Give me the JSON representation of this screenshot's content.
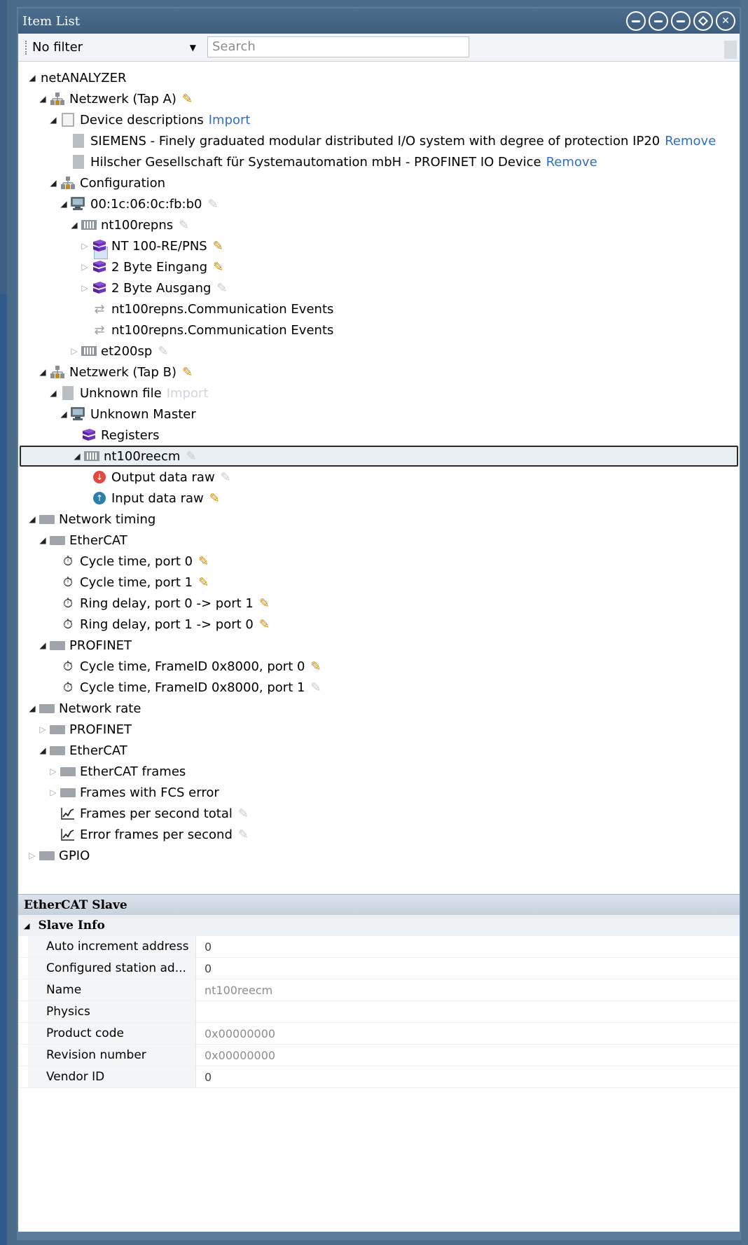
{
  "window": {
    "title": "Item List",
    "buttons": [
      "⊖",
      "⊖",
      "⊜",
      "⊕",
      "⊗"
    ]
  },
  "toolbar": {
    "filter_value": "No filter",
    "search_placeholder": "Search"
  },
  "tree": [
    {
      "depth": 0,
      "exp": "open",
      "icon": "none",
      "label": "netANALYZER"
    },
    {
      "depth": 1,
      "exp": "open",
      "icon": "network",
      "label": "Netzwerk (Tap A)",
      "pencil": "active"
    },
    {
      "depth": 2,
      "exp": "open",
      "icon": "doc",
      "label": "Device descriptions",
      "link": "Import"
    },
    {
      "depth": 3,
      "exp": "none",
      "icon": "docfill",
      "label": "SIEMENS - Finely graduated modular distributed I/O system with degree of protection IP20",
      "link": "Remove"
    },
    {
      "depth": 3,
      "exp": "none",
      "icon": "docfill",
      "label": "Hilscher Gesellschaft für Systemautomation mbH - PROFINET IO Device",
      "link": "Remove"
    },
    {
      "depth": 2,
      "exp": "open",
      "icon": "network",
      "label": "Configuration"
    },
    {
      "depth": 3,
      "exp": "open",
      "icon": "pc",
      "label": "00:1c:06:0c:fb:b0",
      "pencil": "dim"
    },
    {
      "depth": 4,
      "exp": "open",
      "icon": "card",
      "label": "nt100repns",
      "pencil": "dim"
    },
    {
      "depth": 5,
      "exp": "closed",
      "icon": "module",
      "label": "NT 100-RE/PNS",
      "pencil": "active"
    },
    {
      "depth": 5,
      "exp": "closed",
      "icon": "module",
      "label": "2 Byte Eingang",
      "pencil": "active"
    },
    {
      "depth": 5,
      "exp": "closed",
      "icon": "module",
      "label": "2 Byte Ausgang",
      "pencil": "dim"
    },
    {
      "depth": 5,
      "exp": "none",
      "icon": "event",
      "label": "nt100repns.Communication Events"
    },
    {
      "depth": 5,
      "exp": "none",
      "icon": "event",
      "label": "nt100repns.Communication Events"
    },
    {
      "depth": 4,
      "exp": "closed",
      "icon": "card",
      "label": "et200sp",
      "pencil": "dim"
    },
    {
      "depth": 1,
      "exp": "open",
      "icon": "network",
      "label": "Netzwerk (Tap B)",
      "pencil": "active"
    },
    {
      "depth": 2,
      "exp": "open",
      "icon": "docfill",
      "label": "Unknown file",
      "link": "Import",
      "link_dim": true
    },
    {
      "depth": 3,
      "exp": "open",
      "icon": "pc",
      "label": "Unknown Master"
    },
    {
      "depth": 4,
      "exp": "none",
      "icon": "module",
      "label": "Registers"
    },
    {
      "depth": 4,
      "exp": "open",
      "icon": "card",
      "label": "nt100reecm",
      "pencil": "dim",
      "selected": true
    },
    {
      "depth": 5,
      "exp": "none",
      "icon": "down",
      "label": "Output data raw",
      "pencil": "dim"
    },
    {
      "depth": 5,
      "exp": "none",
      "icon": "up",
      "label": "Input data raw",
      "pencil": "active"
    },
    {
      "depth": 0,
      "exp": "open",
      "icon": "folder",
      "label": "Network timing"
    },
    {
      "depth": 1,
      "exp": "open",
      "icon": "folder",
      "label": "EtherCAT"
    },
    {
      "depth": 2,
      "exp": "none",
      "icon": "timer",
      "label": "Cycle time, port 0",
      "pencil": "active"
    },
    {
      "depth": 2,
      "exp": "none",
      "icon": "timer",
      "label": "Cycle time, port 1",
      "pencil": "active"
    },
    {
      "depth": 2,
      "exp": "none",
      "icon": "timer",
      "label": "Ring delay, port 0 -> port 1",
      "pencil": "active"
    },
    {
      "depth": 2,
      "exp": "none",
      "icon": "timer",
      "label": "Ring delay, port 1 -> port 0",
      "pencil": "active"
    },
    {
      "depth": 1,
      "exp": "open",
      "icon": "folder",
      "label": "PROFINET"
    },
    {
      "depth": 2,
      "exp": "none",
      "icon": "timer",
      "label": "Cycle time, FrameID 0x8000, port 0",
      "pencil": "active"
    },
    {
      "depth": 2,
      "exp": "none",
      "icon": "timer",
      "label": "Cycle time, FrameID 0x8000, port 1",
      "pencil": "dim"
    },
    {
      "depth": 0,
      "exp": "open",
      "icon": "folder",
      "label": "Network rate"
    },
    {
      "depth": 1,
      "exp": "closed",
      "icon": "folder",
      "label": "PROFINET"
    },
    {
      "depth": 1,
      "exp": "open",
      "icon": "folder",
      "label": "EtherCAT"
    },
    {
      "depth": 2,
      "exp": "closed",
      "icon": "folder",
      "label": "EtherCAT frames"
    },
    {
      "depth": 2,
      "exp": "closed",
      "icon": "folder",
      "label": "Frames with FCS error"
    },
    {
      "depth": 2,
      "exp": "none",
      "icon": "chart",
      "label": "Frames per second total",
      "pencil": "dim"
    },
    {
      "depth": 2,
      "exp": "none",
      "icon": "chart",
      "label": "Error frames per second",
      "pencil": "dim"
    },
    {
      "depth": 0,
      "exp": "closed",
      "icon": "folder",
      "label": "GPIO"
    }
  ],
  "props": {
    "header": "EtherCAT Slave",
    "category": "Slave Info",
    "rows": [
      {
        "name": "Auto increment address",
        "value": "0",
        "gray": false
      },
      {
        "name": "Configured station ad...",
        "value": "0",
        "gray": false
      },
      {
        "name": "Name",
        "value": "nt100reecm",
        "gray": true
      },
      {
        "name": "Physics",
        "value": "",
        "gray": false
      },
      {
        "name": "Product code",
        "value": "0x00000000",
        "gray": true
      },
      {
        "name": "Revision number",
        "value": "0x00000000",
        "gray": true
      },
      {
        "name": "Vendor ID",
        "value": "0",
        "gray": false
      }
    ]
  }
}
